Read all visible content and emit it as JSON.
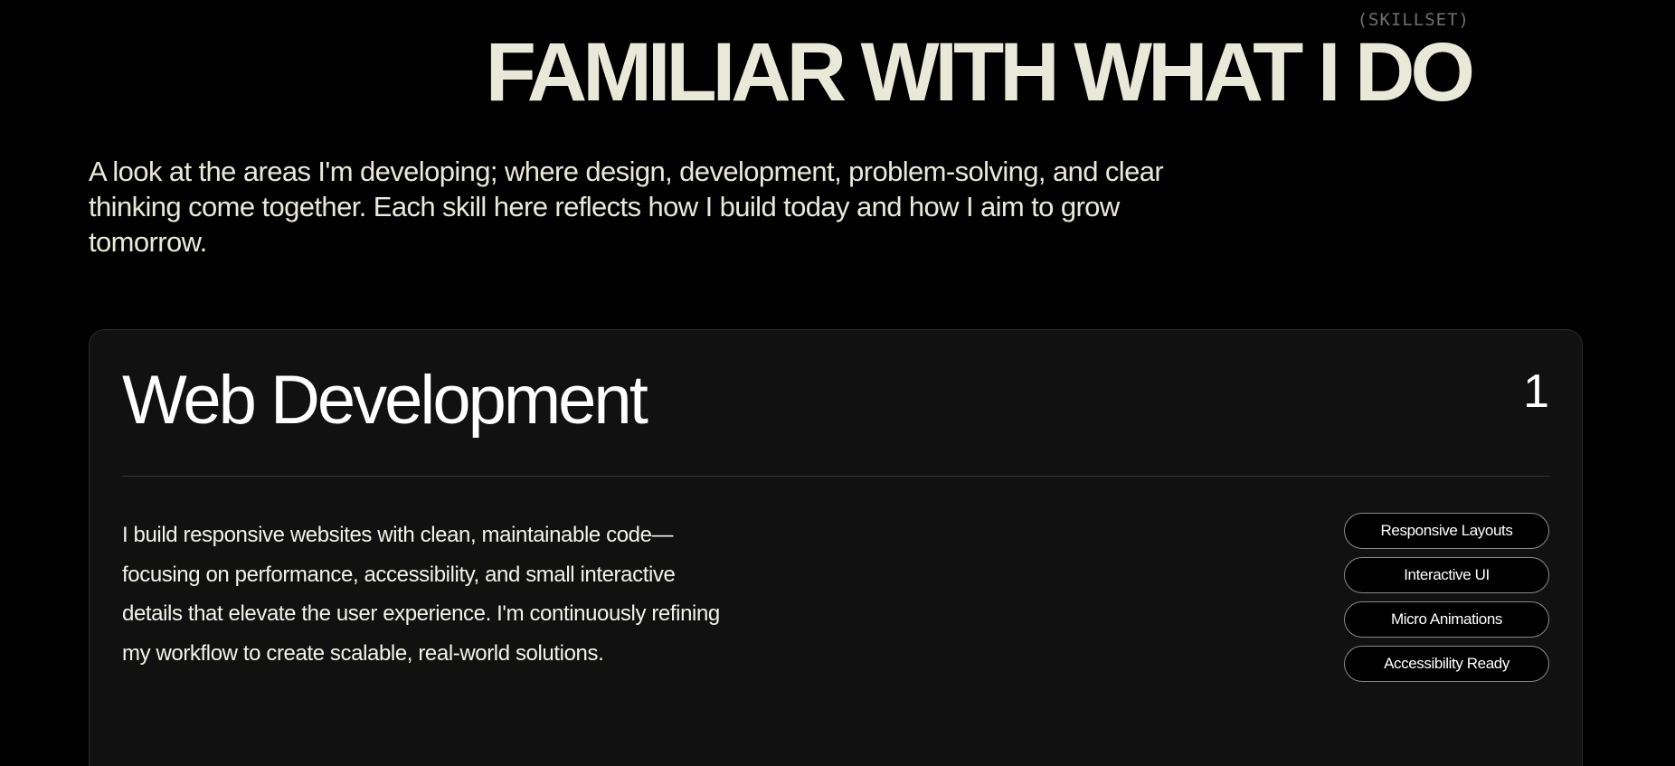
{
  "section": {
    "eyebrow": "(SKILLSET)",
    "headline": "FAMILIAR WITH WHAT I DO",
    "intro": "A look at the areas I'm developing; where design, development, problem-solving, and clear thinking come together. Each skill here reflects how I build today and how I aim to grow tomorrow."
  },
  "card": {
    "title": "Web Development",
    "index": "1",
    "description": "I build responsive websites with clean, maintainable code—focusing on performance, accessibility, and small interactive details that elevate the user experience. I'm continuously refining my workflow to create scalable, real-world solutions.",
    "tags": [
      "Responsive Layouts",
      "Interactive UI",
      "Micro Animations",
      "Accessibility Ready"
    ]
  },
  "colors": {
    "background": "#000000",
    "card_background": "#111111",
    "headline": "#e9e9d9",
    "eyebrow": "#6f6f6a",
    "text": "#ffffff"
  }
}
